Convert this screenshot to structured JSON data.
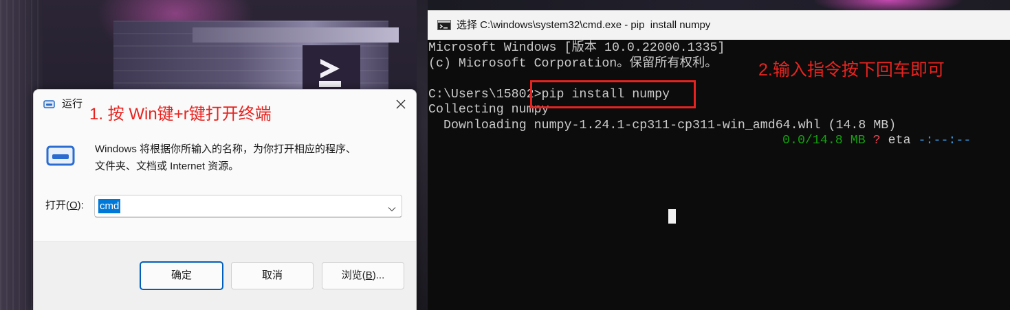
{
  "annotations": {
    "step1": "1. 按 Win键+r键打开终端",
    "step2": "2.输入指令按下回车即可"
  },
  "run_dialog": {
    "title": "运行",
    "description_line1": "Windows 将根据你所输入的名称，为你打开相应的程序、",
    "description_line2": "文件夹、文档或 Internet 资源。",
    "open_label": {
      "prefix": "打开(",
      "mnemonic": "O",
      "suffix": "):"
    },
    "open_value": "cmd",
    "ok_label": "确定",
    "cancel_label": "取消",
    "browse_label": {
      "prefix": "浏览(",
      "mnemonic": "B",
      "suffix": ")..."
    }
  },
  "cmd_window": {
    "title": "选择 C:\\windows\\system32\\cmd.exe - pip  install numpy",
    "lines": {
      "version": "Microsoft Windows [版本 10.0.22000.1335]",
      "copyright": "(c) Microsoft Corporation。保留所有权利。",
      "prompt_command": "C:\\Users\\15802>pip install numpy",
      "collecting": "Collecting numpy",
      "downloading": "Downloading numpy-1.24.1-cp311-cp311-win_amd64.whl (14.8 MB)"
    },
    "progress": {
      "size": "0.0/14.8 MB",
      "rate": "?",
      "eta_label": "eta",
      "eta_value": "-:--:--"
    }
  },
  "colors": {
    "annotation_red": "#e8231f",
    "selection_blue": "#0078d7",
    "primary_button_border": "#005fb8",
    "console_bg": "#0c0c0c",
    "console_text": "#cccccc",
    "progress_green": "#13a10e",
    "progress_red": "#e74856",
    "progress_cyan": "#3a96dd"
  },
  "icons": {
    "run_dialog_title": "run-icon",
    "run_dialog_large": "run-icon",
    "run_dialog_close": "close-icon",
    "combo_dropdown": "chevron-down-icon",
    "cmd_window": "console-icon"
  }
}
